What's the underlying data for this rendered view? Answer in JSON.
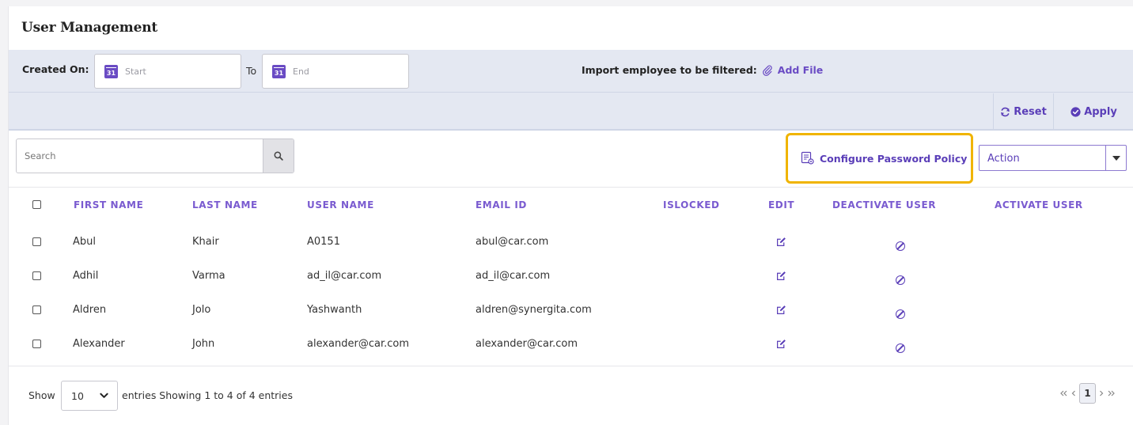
{
  "page": {
    "title": "User Management"
  },
  "filters": {
    "created_on_label": "Created On:",
    "start_placeholder": "Start",
    "to_label": "To",
    "end_placeholder": "End",
    "calendar_day": "31",
    "import_label": "Import employee to be filtered:",
    "add_file_label": "Add File",
    "reset_label": "Reset",
    "apply_label": "Apply"
  },
  "toolbar": {
    "search_placeholder": "Search",
    "configure_label": "Configure Password Policy",
    "action_selected": "Action"
  },
  "table": {
    "headers": [
      "FIRST NAME",
      "LAST NAME",
      "USER NAME",
      "EMAIL ID",
      "ISLOCKED",
      "EDIT",
      "DEACTIVATE USER",
      "ACTIVATE USER"
    ],
    "rows": [
      {
        "first": "Abul",
        "last": "Khair",
        "user": "A0151",
        "email": "abul@car.com"
      },
      {
        "first": "Adhil",
        "last": "Varma",
        "user": "ad_il@car.com",
        "email": "ad_il@car.com"
      },
      {
        "first": "Aldren",
        "last": "Jolo",
        "user": "Yashwanth",
        "email": "aldren@synergita.com"
      },
      {
        "first": "Alexander",
        "last": "John",
        "user": "alexander@car.com",
        "email": "alexander@car.com"
      }
    ]
  },
  "footer": {
    "show_label": "Show",
    "page_size": "10",
    "info": "entries Showing 1 to 4 of 4 entries",
    "current_page": "1"
  },
  "colors": {
    "accent": "#5a3eb8",
    "header_text": "#7a5bd0",
    "highlight": "#f0b400",
    "filter_bg": "#e4e8f2"
  }
}
